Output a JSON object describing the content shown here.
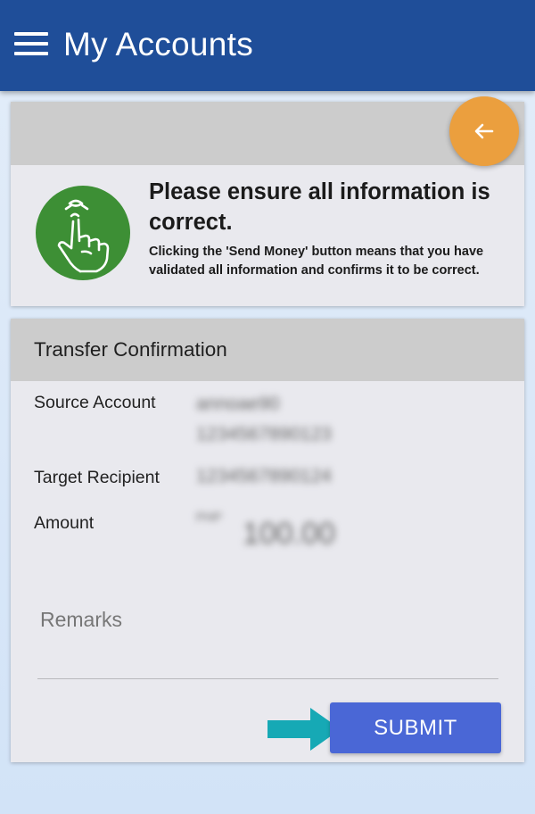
{
  "appbar": {
    "title": "My Accounts",
    "menu_icon": "hamburger-menu-icon",
    "color": "#1f4e99"
  },
  "notice": {
    "heading": "Please ensure all information is correct.",
    "body": "Clicking the 'Send Money' button means that you have validated all information and confirms it to be correct.",
    "icon": "finger-ribbon-reminder-icon",
    "back_icon": "arrow-left-icon",
    "back_color": "#eb9f3e",
    "icon_bg": "#3d8f35"
  },
  "confirmation": {
    "title": "Transfer Confirmation",
    "source_label": "Source Account",
    "source_value_line1": "annoae90",
    "source_value_line2": "1234567890123",
    "target_label": "Target Recipient",
    "target_value": "1234567890124",
    "amount_label": "Amount",
    "amount_currency": "PHP",
    "amount_value": "100.00",
    "remarks_placeholder": "Remarks",
    "submit_label": "SUBMIT",
    "submit_color": "#4a67d6",
    "arrow_color": "#16a9b5"
  }
}
